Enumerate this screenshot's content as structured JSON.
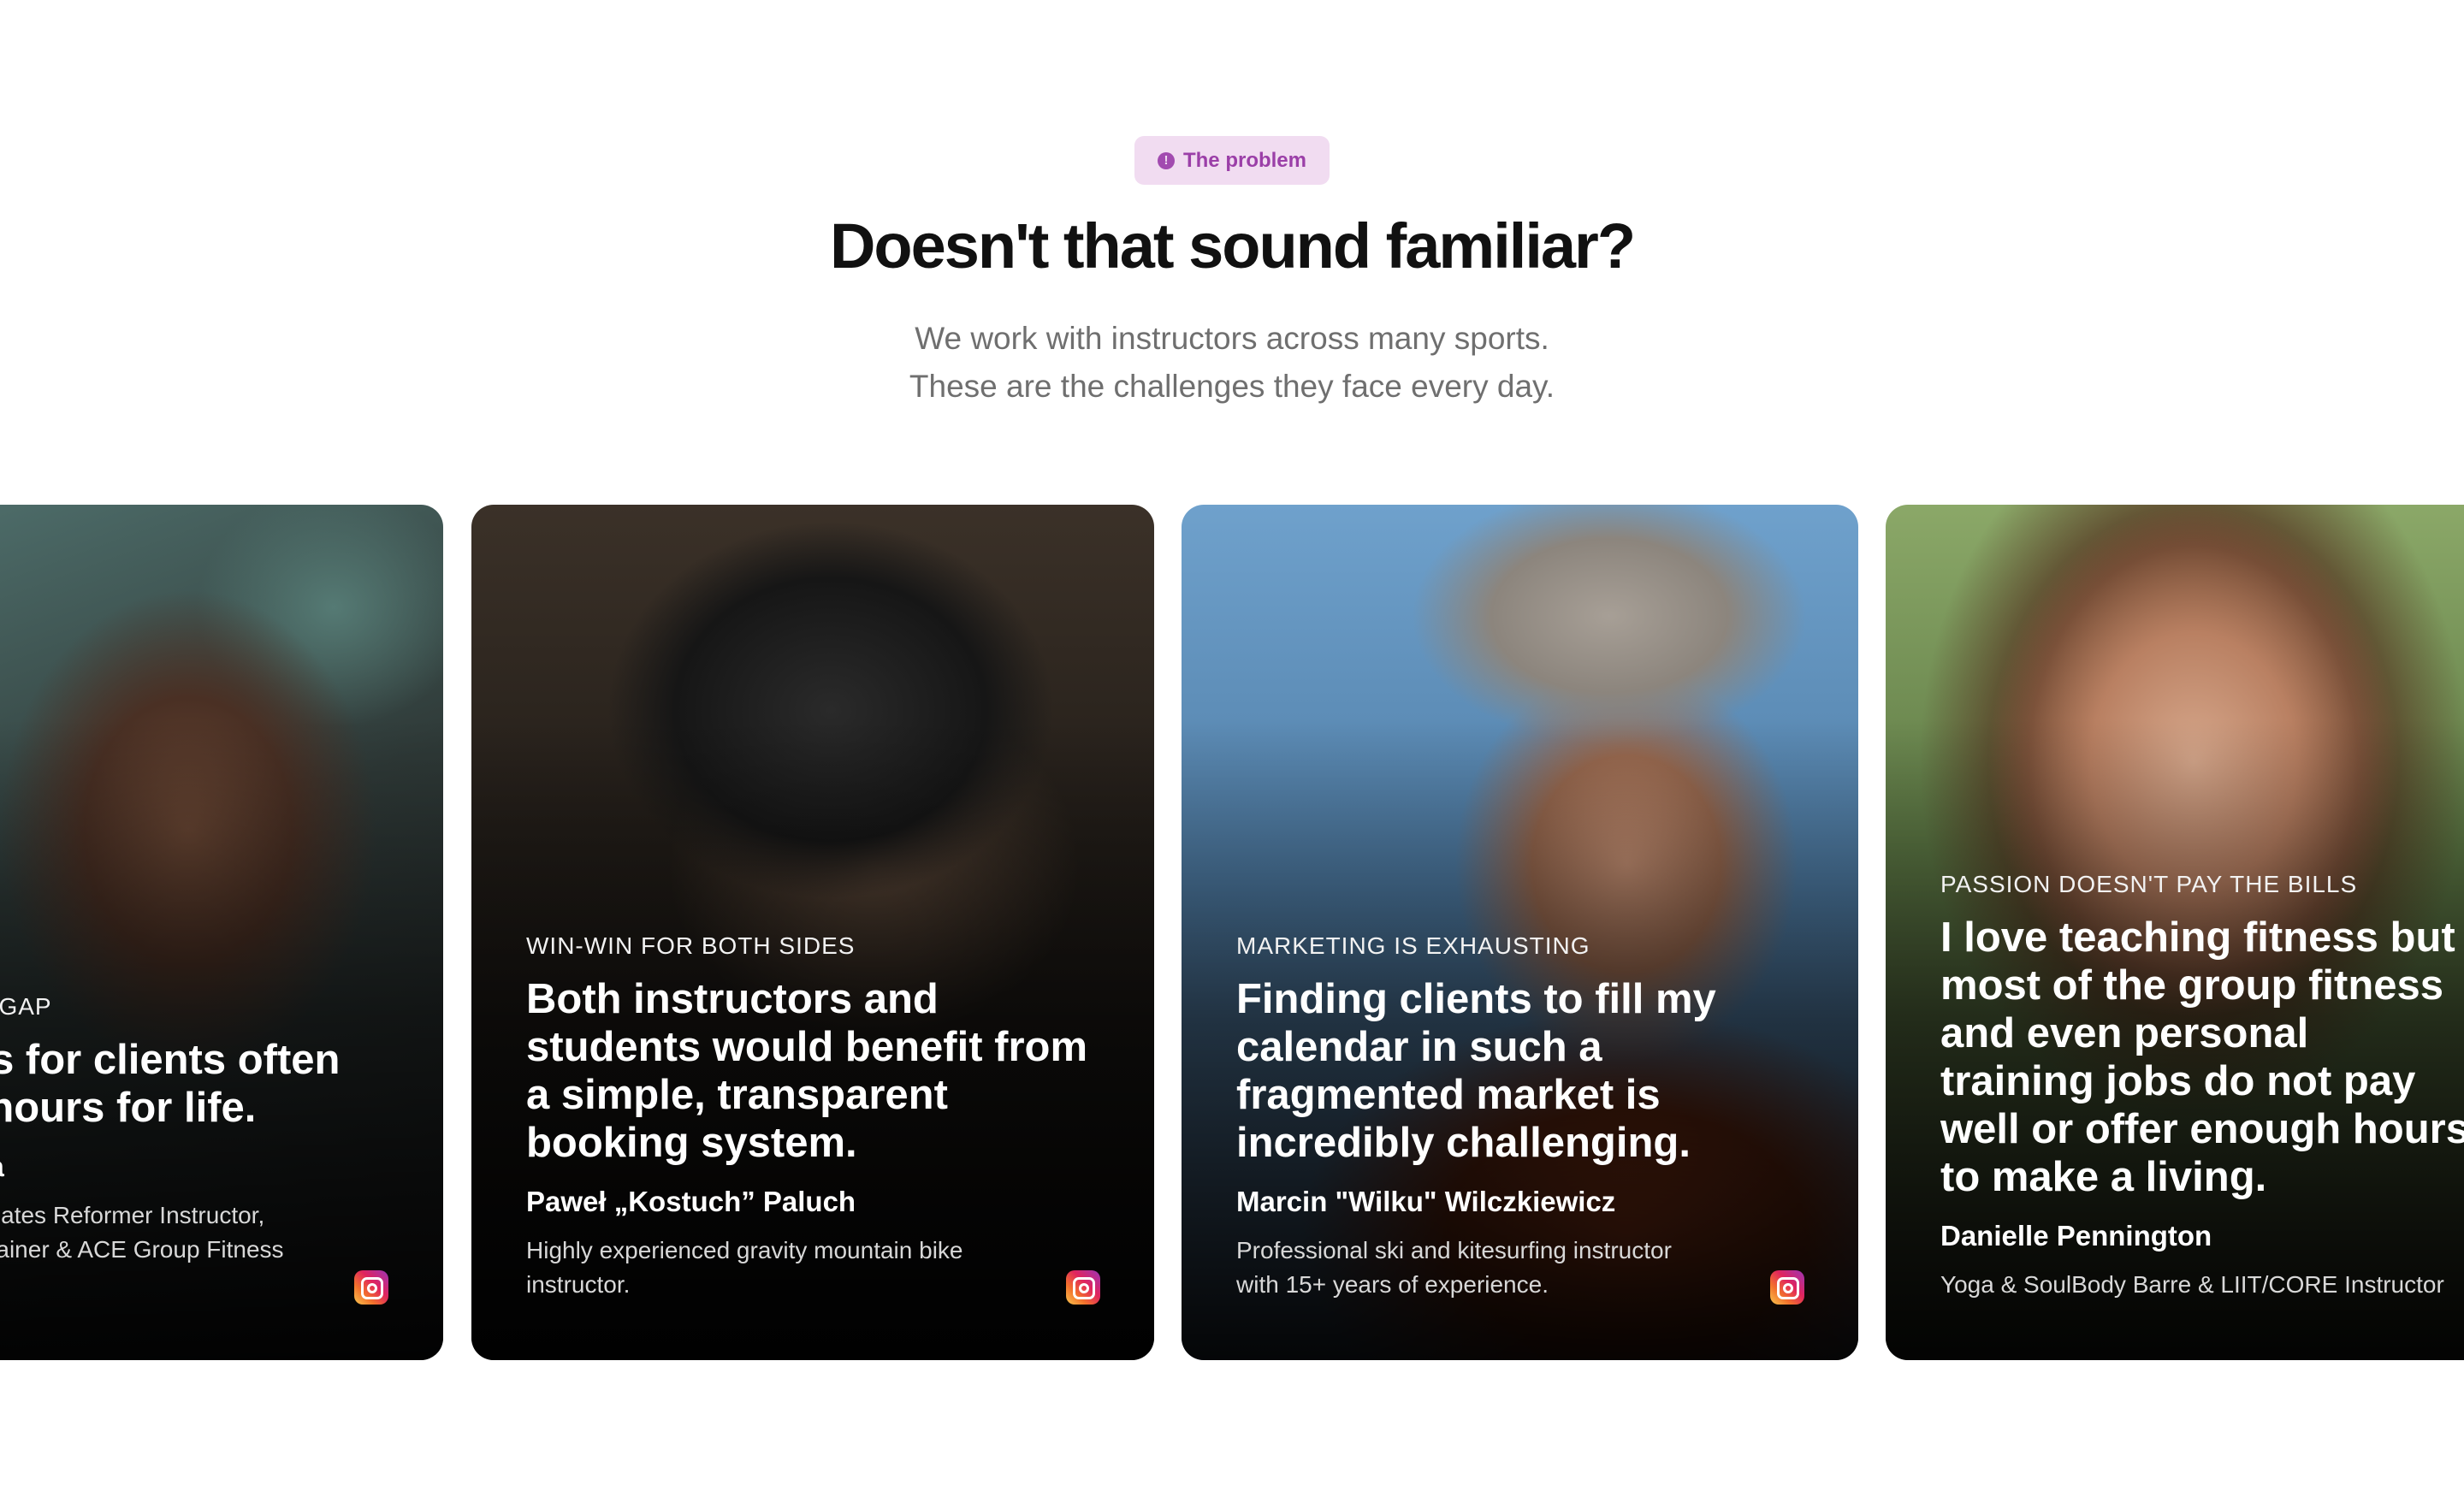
{
  "section": {
    "badge_label": "The problem",
    "title": "Doesn't that sound familiar?",
    "subtitle_line1": "We work with instructors across many sports.",
    "subtitle_line2": "These are the challenges they face every day."
  },
  "cards": [
    {
      "eyebrow": "E GAP",
      "quote": "rs for clients often -hours for life.",
      "quote_line1": "rs for clients often",
      "quote_line2": "-hours for life.",
      "person": "za",
      "role_line1": "Pilates Reformer Instructor,",
      "role_line2": "Trainer & ACE Group Fitness",
      "icon": "instagram-icon"
    },
    {
      "eyebrow": "WIN-WIN FOR BOTH SIDES",
      "quote": "Both instructors and students would benefit from a simple, transparent booking system.",
      "person": "Paweł „Kostuch” Paluch",
      "role": "Highly experienced gravity mountain bike instructor.",
      "icon": "instagram-icon"
    },
    {
      "eyebrow": "MARKETING IS EXHAUSTING",
      "quote": "Finding clients to fill my calendar in such a fragmented market is incredibly challenging.",
      "person": "Marcin \"Wilku\" Wilczkiewicz",
      "role": "Professional ski and kitesurfing instructor with 15+ years of experience.",
      "icon": "instagram-icon"
    },
    {
      "eyebrow": "PASSION DOESN'T PAY THE BILLS",
      "quote": "I love teaching fitness but most of the group fitness and even personal training jobs do not pay well or offer enough hours to make a living.",
      "person": "Danielle Pennington",
      "role": "Yoga & SoulBody Barre & LIIT/CORE Instructor"
    }
  ],
  "colors": {
    "badge_bg": "#f1dcf1",
    "badge_text": "#9b3fa8",
    "title": "#111111",
    "subtitle": "#6f6f6f"
  }
}
